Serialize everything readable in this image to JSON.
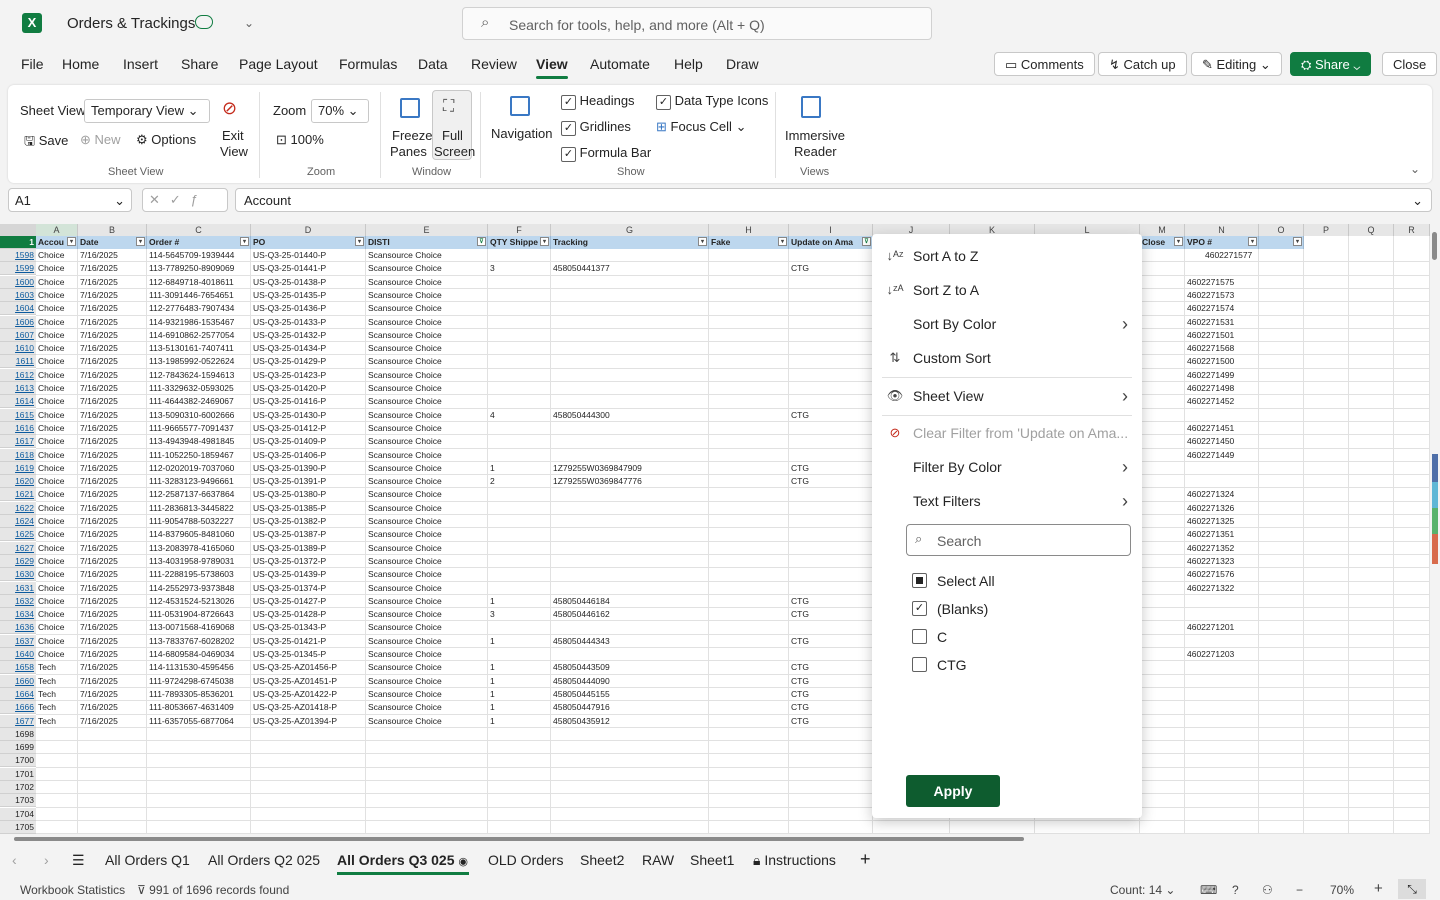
{
  "title_bar": {
    "file_name": "Orders & Trackings",
    "search_placeholder": "Search for tools, help, and more (Alt + Q)"
  },
  "menu": [
    "File",
    "Home",
    "Insert",
    "Share",
    "Page Layout",
    "Formulas",
    "Data",
    "Review",
    "View",
    "Automate",
    "Help",
    "Draw"
  ],
  "header_buttons": {
    "comments": "Comments",
    "catch_up": "Catch up",
    "editing": "Editing",
    "share": "Share",
    "close": "Close"
  },
  "ribbon": {
    "sheet_view_label": "Sheet View",
    "sheet_view_value": "Temporary View",
    "save": "Save",
    "new": "New",
    "options": "Options",
    "exit_view_1": "Exit",
    "exit_view_2": "View",
    "group_sheet_view": "Sheet View",
    "zoom_label": "Zoom",
    "zoom_value": "70%",
    "zoom_100": "100%",
    "group_zoom": "Zoom",
    "freeze_1": "Freeze",
    "freeze_2": "Panes",
    "full_1": "Full",
    "full_2": "Screen",
    "group_window": "Window",
    "navigation": "Navigation",
    "headings": "Headings",
    "gridlines": "Gridlines",
    "formula_bar": "Formula Bar",
    "data_type_icons": "Data Type Icons",
    "focus_cell": "Focus Cell",
    "group_show": "Show",
    "immersive_1": "Immersive",
    "immersive_2": "Reader",
    "group_views": "Views"
  },
  "formula_bar": {
    "name_box": "A1",
    "value": "Account"
  },
  "columns": [
    "A",
    "B",
    "C",
    "D",
    "E",
    "F",
    "G",
    "H",
    "I",
    "J",
    "K",
    "L",
    "M",
    "N",
    "O",
    "P",
    "Q",
    "R"
  ],
  "header_row": {
    "row_num": "1",
    "A": "Accou",
    "B": "Date",
    "C": "Order #",
    "D": "PO",
    "E": "DISTI",
    "F": "QTY Shippe",
    "G": "Tracking",
    "H": "Fake",
    "I": "Update on Ama",
    "M": "Close",
    "N": "VPO #"
  },
  "rows": [
    {
      "n": "1598",
      "a": "Choice",
      "b": "7/16/2025",
      "c": "114-5645709-1939444",
      "d": "US-Q3-25-01440-P",
      "e": "Scansource Choice",
      "f": "",
      "g": "",
      "i": "",
      "nn": "4602271577"
    },
    {
      "n": "1599",
      "a": "Choice",
      "b": "7/16/2025",
      "c": "113-7789250-8909069",
      "d": "US-Q3-25-01441-P",
      "e": "Scansource Choice",
      "f": "3",
      "g": "458050441377",
      "i": "CTG",
      "nn": ""
    },
    {
      "n": "1600",
      "a": "Choice",
      "b": "7/16/2025",
      "c": "112-6849718-4018611",
      "d": "US-Q3-25-01438-P",
      "e": "Scansource Choice",
      "f": "",
      "g": "",
      "i": "",
      "nn": "4602271575"
    },
    {
      "n": "1603",
      "a": "Choice",
      "b": "7/16/2025",
      "c": "111-3091446-7654651",
      "d": "US-Q3-25-01435-P",
      "e": "Scansource Choice",
      "f": "",
      "g": "",
      "i": "",
      "nn": "4602271573"
    },
    {
      "n": "1604",
      "a": "Choice",
      "b": "7/16/2025",
      "c": "112-2776483-7907434",
      "d": "US-Q3-25-01436-P",
      "e": "Scansource Choice",
      "f": "",
      "g": "",
      "i": "",
      "nn": "4602271574"
    },
    {
      "n": "1606",
      "a": "Choice",
      "b": "7/16/2025",
      "c": "114-9321986-1535467",
      "d": "US-Q3-25-01433-P",
      "e": "Scansource Choice",
      "f": "",
      "g": "",
      "i": "",
      "nn": "4602271531"
    },
    {
      "n": "1607",
      "a": "Choice",
      "b": "7/16/2025",
      "c": "114-6910862-2577054",
      "d": "US-Q3-25-01432-P",
      "e": "Scansource Choice",
      "f": "",
      "g": "",
      "i": "",
      "nn": "4602271501"
    },
    {
      "n": "1610",
      "a": "Choice",
      "b": "7/16/2025",
      "c": "113-5130161-7407411",
      "d": "US-Q3-25-01434-P",
      "e": "Scansource Choice",
      "f": "",
      "g": "",
      "i": "",
      "nn": "4602271568"
    },
    {
      "n": "1611",
      "a": "Choice",
      "b": "7/16/2025",
      "c": "113-1985992-0522624",
      "d": "US-Q3-25-01429-P",
      "e": "Scansource Choice",
      "f": "",
      "g": "",
      "i": "",
      "nn": "4602271500"
    },
    {
      "n": "1612",
      "a": "Choice",
      "b": "7/16/2025",
      "c": "112-7843624-1594613",
      "d": "US-Q3-25-01423-P",
      "e": "Scansource Choice",
      "f": "",
      "g": "",
      "i": "",
      "nn": "4602271499"
    },
    {
      "n": "1613",
      "a": "Choice",
      "b": "7/16/2025",
      "c": "111-3329632-0593025",
      "d": "US-Q3-25-01420-P",
      "e": "Scansource Choice",
      "f": "",
      "g": "",
      "i": "",
      "nn": "4602271498"
    },
    {
      "n": "1614",
      "a": "Choice",
      "b": "7/16/2025",
      "c": "111-4644382-2469067",
      "d": "US-Q3-25-01416-P",
      "e": "Scansource Choice",
      "f": "",
      "g": "",
      "i": "",
      "nn": "4602271452"
    },
    {
      "n": "1615",
      "a": "Choice",
      "b": "7/16/2025",
      "c": "113-5090310-6002666",
      "d": "US-Q3-25-01430-P",
      "e": "Scansource Choice",
      "f": "4",
      "g": "458050444300",
      "i": "CTG",
      "nn": ""
    },
    {
      "n": "1616",
      "a": "Choice",
      "b": "7/16/2025",
      "c": "111-9665577-7091437",
      "d": "US-Q3-25-01412-P",
      "e": "Scansource Choice",
      "f": "",
      "g": "",
      "i": "",
      "nn": "4602271451"
    },
    {
      "n": "1617",
      "a": "Choice",
      "b": "7/16/2025",
      "c": "113-4943948-4981845",
      "d": "US-Q3-25-01409-P",
      "e": "Scansource Choice",
      "f": "",
      "g": "",
      "i": "",
      "nn": "4602271450"
    },
    {
      "n": "1618",
      "a": "Choice",
      "b": "7/16/2025",
      "c": "111-1052250-1859467",
      "d": "US-Q3-25-01406-P",
      "e": "Scansource Choice",
      "f": "",
      "g": "",
      "i": "",
      "nn": "4602271449"
    },
    {
      "n": "1619",
      "a": "Choice",
      "b": "7/16/2025",
      "c": "112-0202019-7037060",
      "d": "US-Q3-25-01390-P",
      "e": "Scansource Choice",
      "f": "1",
      "g": "1Z79255W0369847909",
      "i": "CTG",
      "nn": ""
    },
    {
      "n": "1620",
      "a": "Choice",
      "b": "7/16/2025",
      "c": "111-3283123-9496661",
      "d": "US-Q3-25-01391-P",
      "e": "Scansource Choice",
      "f": "2",
      "g": "1Z79255W0369847776",
      "i": "CTG",
      "nn": ""
    },
    {
      "n": "1621",
      "a": "Choice",
      "b": "7/16/2025",
      "c": "112-2587137-6637864",
      "d": "US-Q3-25-01380-P",
      "e": "Scansource Choice",
      "f": "",
      "g": "",
      "i": "",
      "nn": "4602271324"
    },
    {
      "n": "1622",
      "a": "Choice",
      "b": "7/16/2025",
      "c": "111-2836813-3445822",
      "d": "US-Q3-25-01385-P",
      "e": "Scansource Choice",
      "f": "",
      "g": "",
      "i": "",
      "nn": "4602271326"
    },
    {
      "n": "1624",
      "a": "Choice",
      "b": "7/16/2025",
      "c": "111-9054788-5032227",
      "d": "US-Q3-25-01382-P",
      "e": "Scansource Choice",
      "f": "",
      "g": "",
      "i": "",
      "nn": "4602271325"
    },
    {
      "n": "1625",
      "a": "Choice",
      "b": "7/16/2025",
      "c": "114-8379605-8481060",
      "d": "US-Q3-25-01387-P",
      "e": "Scansource Choice",
      "f": "",
      "g": "",
      "i": "",
      "nn": "4602271351"
    },
    {
      "n": "1627",
      "a": "Choice",
      "b": "7/16/2025",
      "c": "113-2083978-4165060",
      "d": "US-Q3-25-01389-P",
      "e": "Scansource Choice",
      "f": "",
      "g": "",
      "i": "",
      "nn": "4602271352"
    },
    {
      "n": "1629",
      "a": "Choice",
      "b": "7/16/2025",
      "c": "113-4031958-9789031",
      "d": "US-Q3-25-01372-P",
      "e": "Scansource Choice",
      "f": "",
      "g": "",
      "i": "",
      "nn": "4602271323"
    },
    {
      "n": "1630",
      "a": "Choice",
      "b": "7/16/2025",
      "c": "111-2288195-5738603",
      "d": "US-Q3-25-01439-P",
      "e": "Scansource Choice",
      "f": "",
      "g": "",
      "i": "",
      "nn": "4602271576"
    },
    {
      "n": "1631",
      "a": "Choice",
      "b": "7/16/2025",
      "c": "114-2552973-9373848",
      "d": "US-Q3-25-01374-P",
      "e": "Scansource Choice",
      "f": "",
      "g": "",
      "i": "",
      "nn": "4602271322"
    },
    {
      "n": "1632",
      "a": "Choice",
      "b": "7/16/2025",
      "c": "112-4531524-5213026",
      "d": "US-Q3-25-01427-P",
      "e": "Scansource Choice",
      "f": "1",
      "g": "458050446184",
      "i": "CTG",
      "nn": ""
    },
    {
      "n": "1634",
      "a": "Choice",
      "b": "7/16/2025",
      "c": "111-0531904-8726643",
      "d": "US-Q3-25-01428-P",
      "e": "Scansource Choice",
      "f": "3",
      "g": "458050446162",
      "i": "CTG",
      "nn": ""
    },
    {
      "n": "1636",
      "a": "Choice",
      "b": "7/16/2025",
      "c": "113-0071568-4169068",
      "d": "US-Q3-25-01343-P",
      "e": "Scansource Choice",
      "f": "",
      "g": "",
      "i": "",
      "nn": "4602271201"
    },
    {
      "n": "1637",
      "a": "Choice",
      "b": "7/16/2025",
      "c": "113-7833767-6028202",
      "d": "US-Q3-25-01421-P",
      "e": "Scansource Choice",
      "f": "1",
      "g": "458050444343",
      "i": "CTG",
      "nn": ""
    },
    {
      "n": "1640",
      "a": "Choice",
      "b": "7/16/2025",
      "c": "114-6809584-0469034",
      "d": "US-Q3-25-01345-P",
      "e": "Scansource Choice",
      "f": "",
      "g": "",
      "i": "",
      "nn": "4602271203"
    },
    {
      "n": "1658",
      "a": "Tech",
      "b": "7/16/2025",
      "c": "114-1131530-4595456",
      "d": "US-Q3-25-AZ01456-P",
      "e": "Scansource Choice",
      "f": "1",
      "g": "458050443509",
      "i": "CTG",
      "nn": ""
    },
    {
      "n": "1660",
      "a": "Tech",
      "b": "7/16/2025",
      "c": "111-9724298-6745038",
      "d": "US-Q3-25-AZ01451-P",
      "e": "Scansource Choice",
      "f": "1",
      "g": "458050444090",
      "i": "CTG",
      "nn": ""
    },
    {
      "n": "1664",
      "a": "Tech",
      "b": "7/16/2025",
      "c": "111-7893305-8536201",
      "d": "US-Q3-25-AZ01422-P",
      "e": "Scansource Choice",
      "f": "1",
      "g": "458050445155",
      "i": "CTG",
      "nn": ""
    },
    {
      "n": "1666",
      "a": "Tech",
      "b": "7/16/2025",
      "c": "111-8053667-4631409",
      "d": "US-Q3-25-AZ01418-P",
      "e": "Scansource Choice",
      "f": "1",
      "g": "458050447916",
      "i": "CTG",
      "nn": ""
    },
    {
      "n": "1677",
      "a": "Tech",
      "b": "7/16/2025",
      "c": "111-6357055-6877064",
      "d": "US-Q3-25-AZ01394-P",
      "e": "Scansource Choice",
      "f": "1",
      "g": "458050435912",
      "i": "CTG",
      "nn": ""
    }
  ],
  "empty_rows": [
    "1698",
    "1699",
    "1700",
    "1701",
    "1702",
    "1703",
    "1704",
    "1705"
  ],
  "filter_popup": {
    "sort_az": "Sort A to Z",
    "sort_za": "Sort Z to A",
    "sort_by_color": "Sort By Color",
    "custom_sort": "Custom Sort",
    "sheet_view": "Sheet View",
    "clear_filter": "Clear Filter from 'Update on Ama...",
    "filter_by_color": "Filter By Color",
    "text_filters": "Text Filters",
    "search_placeholder": "Search",
    "items": [
      {
        "label": "Select All",
        "state": "partial"
      },
      {
        "label": "(Blanks)",
        "state": "checked"
      },
      {
        "label": "C",
        "state": "unchecked"
      },
      {
        "label": "CTG",
        "state": "unchecked"
      }
    ],
    "apply": "Apply"
  },
  "sheet_tabs": [
    "All Orders Q1",
    "All Orders Q2 025",
    "All Orders Q3 025",
    "OLD Orders",
    "Sheet2",
    "RAW",
    "Sheet1",
    "Instructions"
  ],
  "active_tab": "All Orders Q3 025",
  "status": {
    "workbook_stats": "Workbook Statistics",
    "records": "991 of 1696 records found",
    "count": "Count: 14",
    "zoom": "70%"
  },
  "colors": {
    "accent": "#107c41",
    "header_fill": "#bdd7ee",
    "apply_button": "#0e5c2f"
  }
}
